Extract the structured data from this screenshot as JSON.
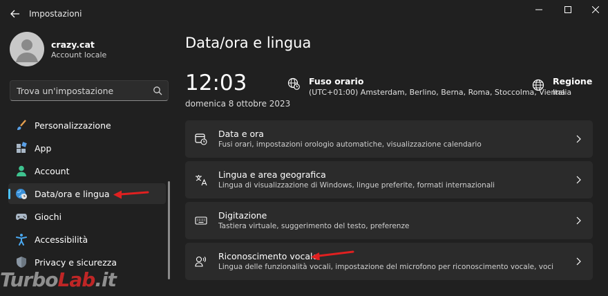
{
  "window": {
    "title": "Impostazioni"
  },
  "profile": {
    "name": "crazy.cat",
    "type": "Account locale"
  },
  "search": {
    "placeholder": "Trova un'impostazione"
  },
  "nav": {
    "items": [
      {
        "label": "Personalizzazione",
        "icon": "brush-icon"
      },
      {
        "label": "App",
        "icon": "apps-icon"
      },
      {
        "label": "Account",
        "icon": "person-icon"
      },
      {
        "label": "Data/ora e lingua",
        "icon": "globe-clock-icon",
        "active": true
      },
      {
        "label": "Giochi",
        "icon": "gamepad-icon"
      },
      {
        "label": "Accessibilità",
        "icon": "accessibility-icon"
      },
      {
        "label": "Privacy e sicurezza",
        "icon": "shield-icon"
      }
    ]
  },
  "main": {
    "title": "Data/ora e lingua",
    "time": "12:03",
    "date": "domenica 8 ottobre 2023",
    "timezone": {
      "title": "Fuso orario",
      "value": "(UTC+01:00) Amsterdam, Berlino, Berna, Roma, Stoccolma, Vienna"
    },
    "region": {
      "title": "Regione",
      "value": "Italia"
    },
    "cards": [
      {
        "title": "Data e ora",
        "desc": "Fusi orari, impostazioni orologio automatiche, visualizzazione calendario",
        "icon": "calendar-clock-icon"
      },
      {
        "title": "Lingua e area geografica",
        "desc": "Lingua di visualizzazione di Windows, lingue preferite, formati internazionali",
        "icon": "language-icon"
      },
      {
        "title": "Digitazione",
        "desc": "Tastiera virtuale, suggerimento del testo, preferenze",
        "icon": "keyboard-icon"
      },
      {
        "title": "Riconoscimento vocale",
        "desc": "Lingua delle funzionalità vocali, impostazione del microfono per riconoscimento vocale, voci",
        "icon": "speech-icon"
      }
    ]
  },
  "watermark": {
    "part1": "Turbo",
    "part2": "Lab",
    "part3": ".it"
  },
  "colors": {
    "background": "#202020",
    "card": "#2b2b2b",
    "accent": "#4cc2ff",
    "annotation_arrow": "#e02020"
  }
}
